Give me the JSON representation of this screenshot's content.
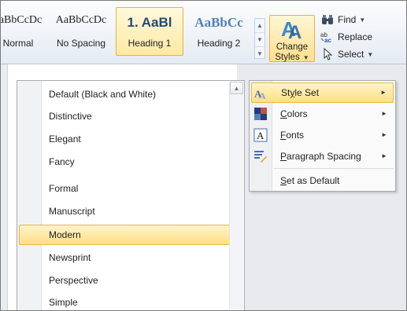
{
  "ribbon": {
    "styles_gallery": [
      {
        "preview": "AaBbCcDc",
        "name": "Normal"
      },
      {
        "preview": "AaBbCcDc",
        "name": "No Spacing"
      },
      {
        "preview": "1. AaBl",
        "name": "Heading 1"
      },
      {
        "preview": "AaBbCc",
        "name": "Heading 2"
      }
    ],
    "gallery_scroll": [
      "up-arrow",
      "down-arrow",
      "more-arrow"
    ],
    "change_styles": {
      "label_line1": "Change",
      "label_line2": "Styles",
      "icon": "change-styles-icon"
    },
    "editing": {
      "find": "Find",
      "replace": "Replace",
      "select": "Select"
    }
  },
  "style_set_menu": {
    "items": [
      "Default (Black and White)",
      "Distinctive",
      "Elegant",
      "Fancy",
      "Formal",
      "Manuscript",
      "Modern",
      "Newsprint",
      "Perspective",
      "Simple"
    ],
    "selected": "Modern"
  },
  "change_styles_menu": {
    "items": [
      {
        "label": "Style Set",
        "accel": "y",
        "icon": "style-set-icon",
        "submenu": true
      },
      {
        "label": "Colors",
        "accel": "C",
        "icon": "colors-icon",
        "submenu": true
      },
      {
        "label": "Fonts",
        "accel": "F",
        "icon": "fonts-icon",
        "submenu": true
      },
      {
        "label": "Paragraph Spacing",
        "accel": "P",
        "icon": "paragraph-spacing-icon",
        "submenu": true
      },
      {
        "label": "Set as Default",
        "accel": "S",
        "icon": "",
        "submenu": false
      }
    ],
    "hovered": "Style Set"
  },
  "colors": {
    "accent_highlight": "#ffdf85",
    "heading1_color": "#1f497d",
    "heading2_color": "#4f81bd"
  }
}
